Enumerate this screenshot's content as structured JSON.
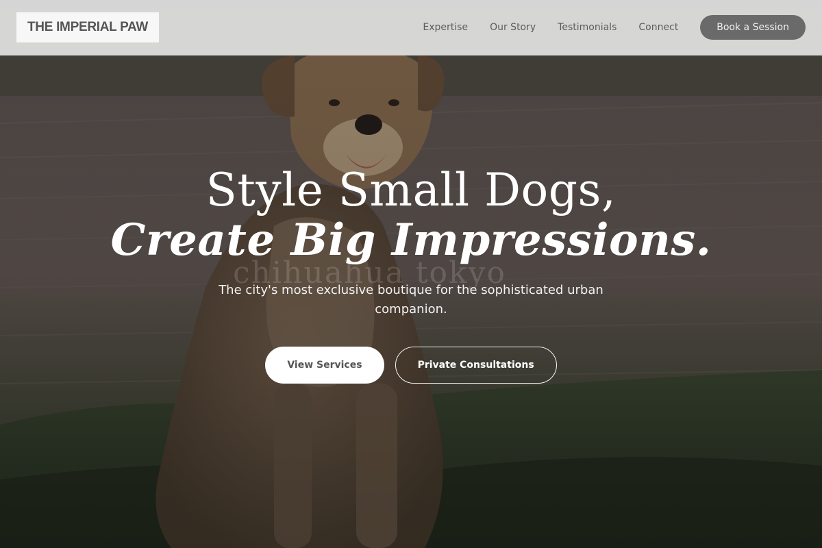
{
  "brand": {
    "logo_text": "THE IMPERIAL PAW"
  },
  "nav": {
    "links": [
      "Expertise",
      "Our Story",
      "Testimonials",
      "Connect"
    ],
    "cta_label": "Book a Session"
  },
  "hero": {
    "title_line1": "Style Small Dogs,",
    "title_line2": "Create Big Impressions.",
    "subtitle": "The city's most exclusive boutique for the sophisticated urban companion.",
    "primary_button": "View Services",
    "secondary_button": "Private Consultations",
    "image_watermark": "chihuahua tokyo"
  },
  "colors": {
    "header_bg": "#e1e1e1",
    "cta_bg": "#6a6a6a",
    "hero_text": "#ffffff"
  }
}
